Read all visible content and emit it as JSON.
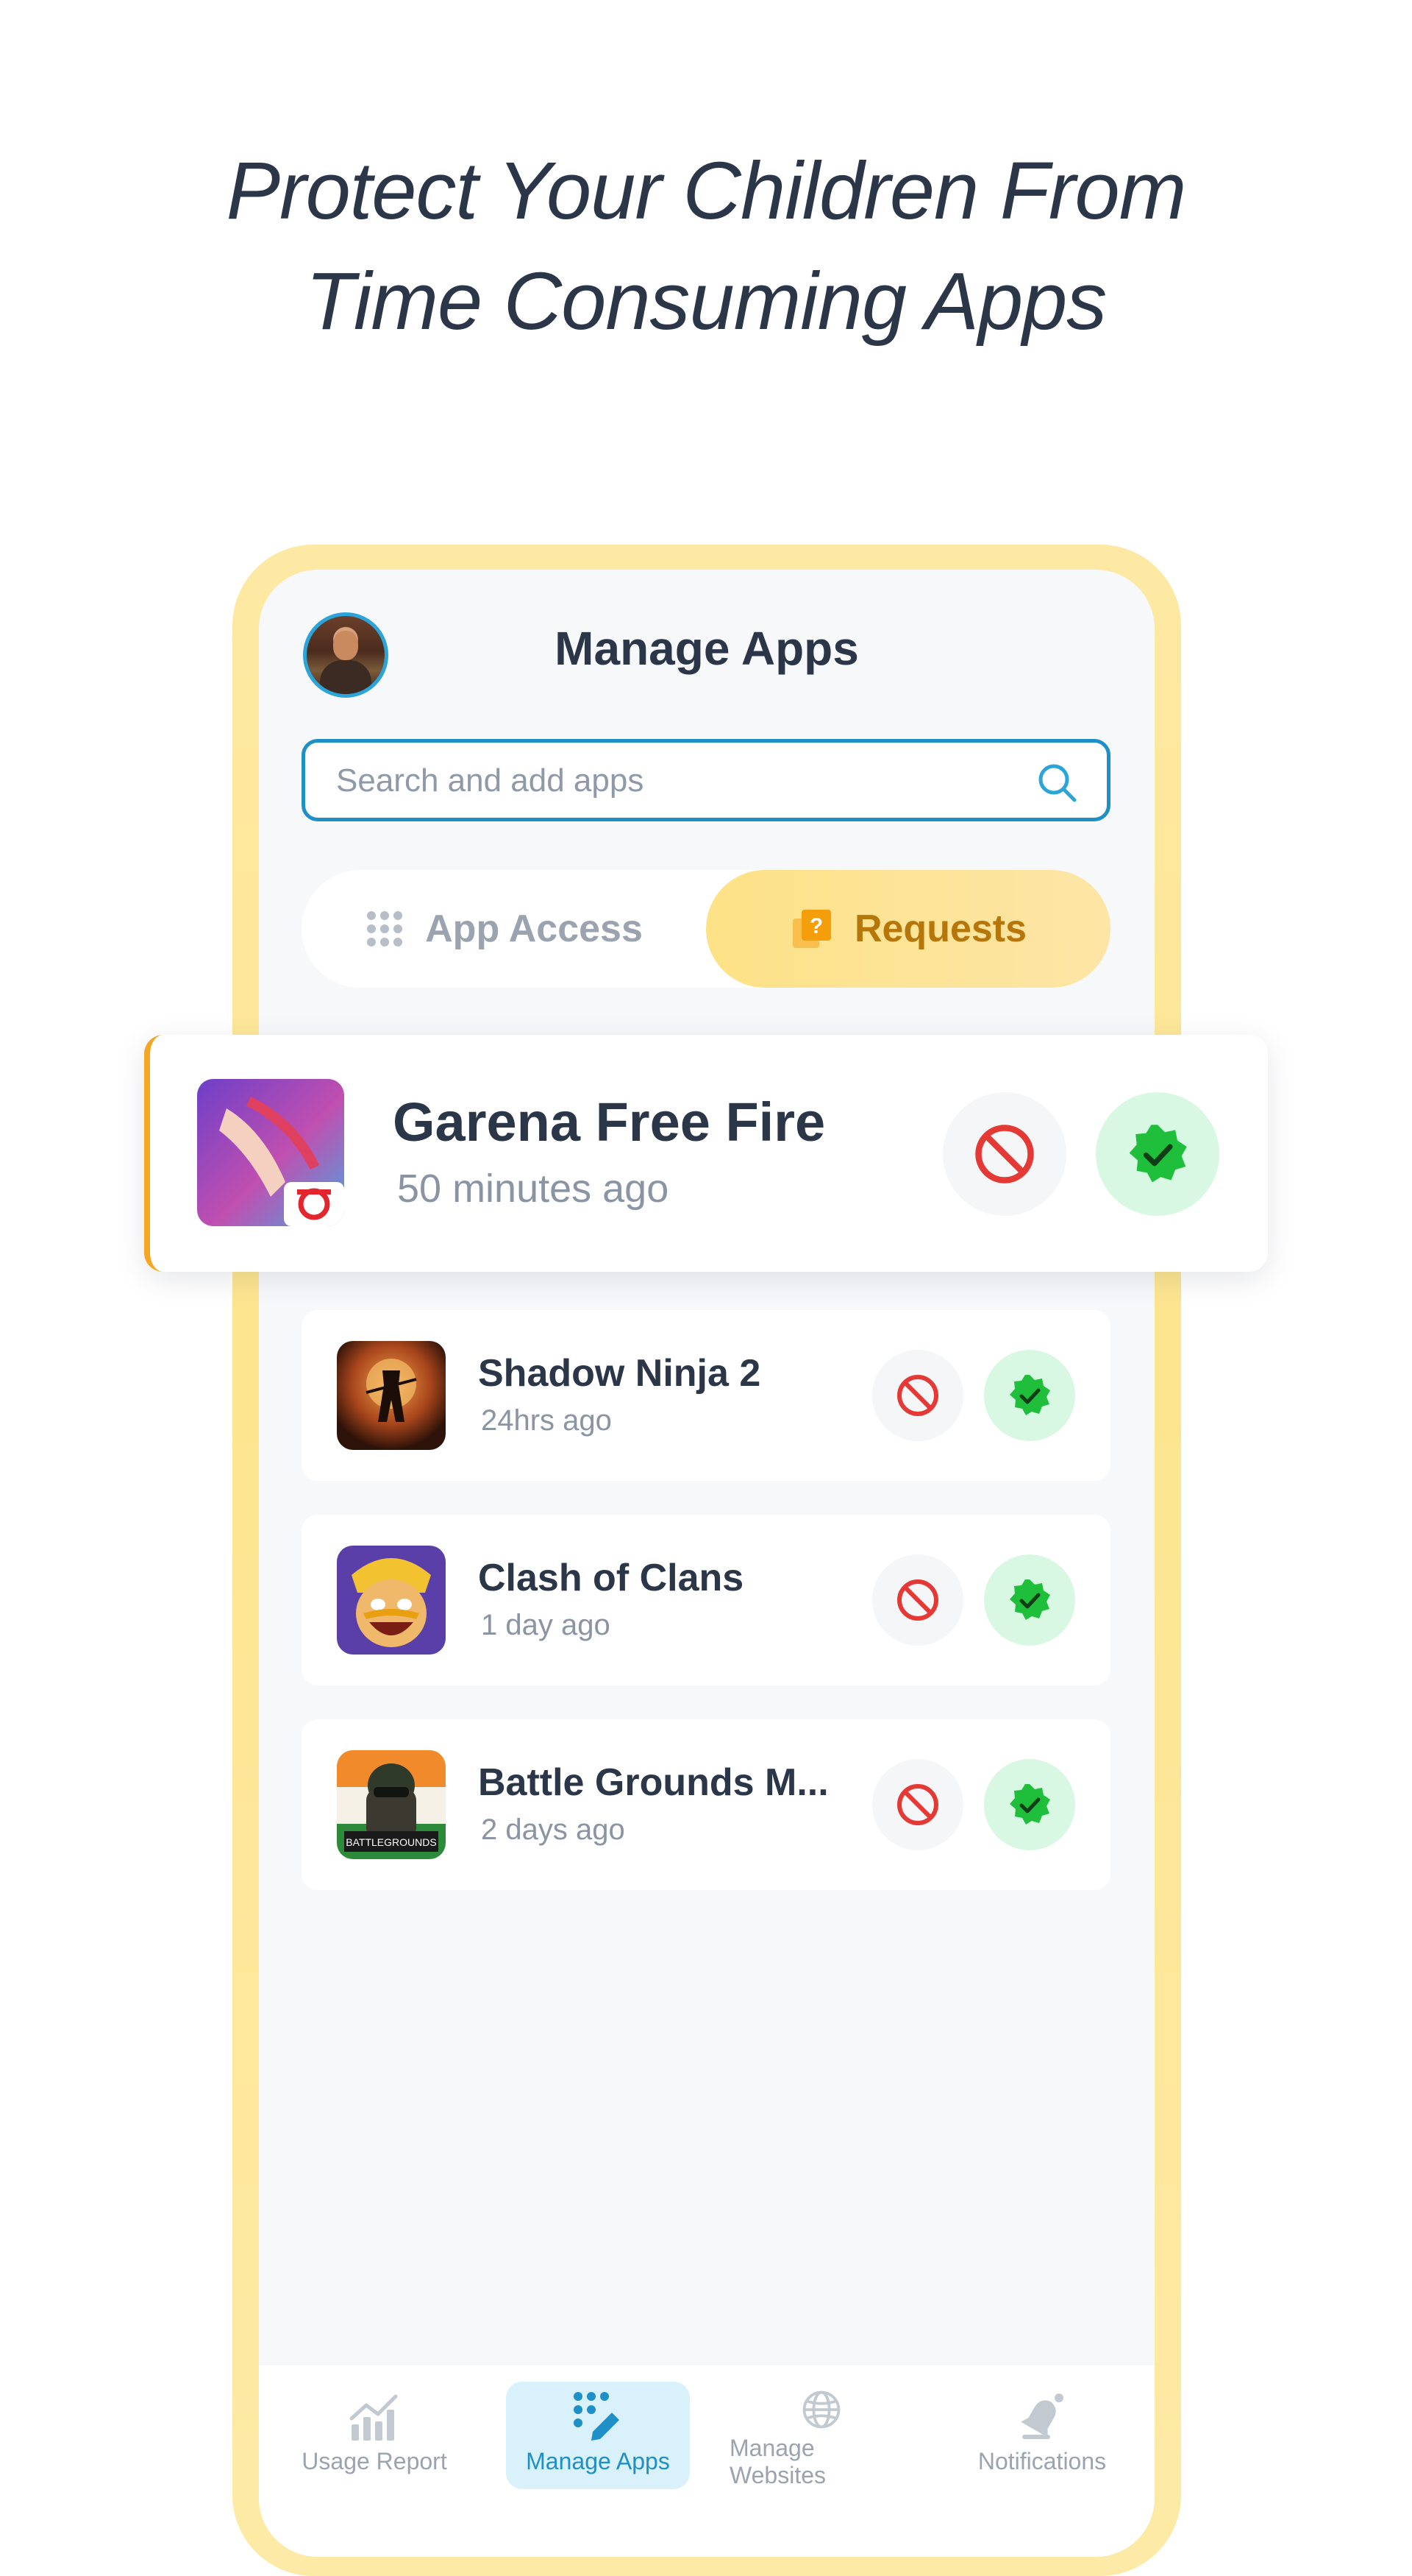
{
  "headline": {
    "line1": "Protect Your Children From",
    "line2": "Time Consuming Apps"
  },
  "screen": {
    "title": "Manage Apps",
    "search": {
      "placeholder": "Search and add apps"
    },
    "tabs": [
      {
        "label": "App Access",
        "active": false
      },
      {
        "label": "Requests",
        "active": true
      }
    ],
    "featured": {
      "name": "Garena Free Fire",
      "time": "50 minutes ago"
    },
    "requests": [
      {
        "name": "Shadow Ninja 2",
        "time": "24hrs ago"
      },
      {
        "name": "Clash of Clans",
        "time": "1 day ago"
      },
      {
        "name": "Battle Grounds M...",
        "time": "2 days ago"
      }
    ],
    "bottom_nav": [
      {
        "label": "Usage Report",
        "icon": "chart-icon",
        "active": false
      },
      {
        "label": "Manage Apps",
        "icon": "apps-edit-icon",
        "active": true
      },
      {
        "label": "Manage Websites",
        "icon": "globe-icon",
        "active": false
      },
      {
        "label": "Notifications",
        "icon": "bell-icon",
        "active": false
      }
    ]
  },
  "colors": {
    "accent_blue": "#1f8fc7",
    "requests_tab": "#fde287",
    "deny_red": "#e53935",
    "approve_green": "#1fbf3c",
    "text_dark": "#2b3648"
  }
}
